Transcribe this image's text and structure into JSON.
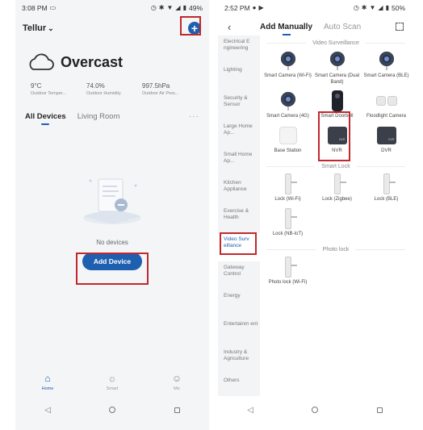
{
  "left": {
    "status": {
      "time": "3:08 PM",
      "battery": "49%"
    },
    "home_name": "Tellur",
    "weather": {
      "condition": "Overcast",
      "stats": [
        {
          "value": "9°C",
          "label": "Outdoor Temper..."
        },
        {
          "value": "74.0%",
          "label": "Outdoor Humidity"
        },
        {
          "value": "997.5hPa",
          "label": "Outdoor Air Pres..."
        }
      ]
    },
    "tabs": [
      "All Devices",
      "Living Room"
    ],
    "empty_text": "No devices",
    "add_device_label": "Add Device",
    "bottom_nav": [
      "Home",
      "Smart",
      "Me"
    ]
  },
  "right": {
    "status": {
      "time": "2:52 PM",
      "battery": "50%"
    },
    "tabs": [
      "Add Manually",
      "Auto Scan"
    ],
    "categories": [
      "Electrical E ngineering",
      "Lighting",
      "Security & Sensor",
      "Large Home Ap...",
      "Small Home Ap...",
      "Kitchen Appliance",
      "Exercise & Health",
      "Video Surv eillance",
      "Gateway Control",
      "Energy",
      "Entertainm ent",
      "Industry & Agriculture",
      "Others"
    ],
    "sections": {
      "video": {
        "title": "Video Surveillance",
        "items": [
          "Smart Camera (Wi-Fi)",
          "Smart Camera (Dual Band)",
          "Smart Camera (BLE)",
          "Smart Camera (4G)",
          "Smart Doorbell",
          "Floodlight Camera",
          "Base Station",
          "NVR",
          "DVR"
        ]
      },
      "lock": {
        "title": "Smart Lock",
        "items": [
          "Lock (Wi-Fi)",
          "Lock (Zigbee)",
          "Lock (BLE)",
          "Lock (NB-IoT)"
        ]
      },
      "photo": {
        "title": "Photo lock",
        "items": [
          "Photo lock (Wi-Fi)"
        ]
      }
    },
    "nvr_badge": "NVR",
    "dvr_badge": "DVR"
  },
  "colors": {
    "accent": "#1e5fb0",
    "highlight_box": "#c0282e"
  }
}
